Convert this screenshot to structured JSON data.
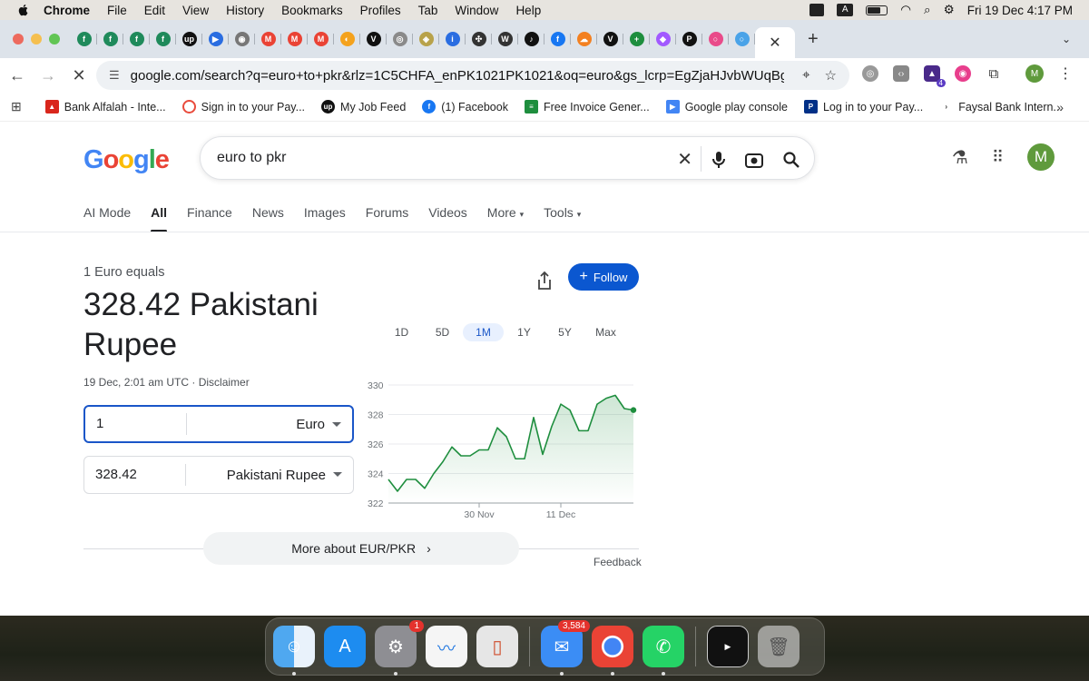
{
  "menubar": {
    "app": "Chrome",
    "items": [
      "File",
      "Edit",
      "View",
      "History",
      "Bookmarks",
      "Profiles",
      "Tab",
      "Window",
      "Help"
    ],
    "clock": "Fri 19 Dec  4:17 PM"
  },
  "browser": {
    "url": "google.com/search?q=euro+to+pkr&rlz=1C5CHFA_enPK1021PK1021&oq=euro&gs_lcrp=EgZjaHJvbWUqBggAEEU...",
    "ext_badge": "4",
    "profile_initial": "M"
  },
  "bookmarks": [
    "Bank Alfalah - Inte...",
    "Sign in to your Pay...",
    "My Job Feed",
    "(1) Facebook",
    "Free Invoice Gener...",
    "Google play console",
    "Log in to your Pay...",
    "Faysal Bank Intern..."
  ],
  "google": {
    "query": "euro to pkr",
    "profile_initial": "M",
    "tabs": [
      "AI Mode",
      "All",
      "Finance",
      "News",
      "Images",
      "Forums",
      "Videos",
      "More",
      "Tools"
    ]
  },
  "converter": {
    "equals": "1 Euro equals",
    "result": "328.42 Pakistani Rupee",
    "timestamp": "19 Dec, 2:01 am UTC · Disclaimer",
    "from_value": "1",
    "from_currency": "Euro",
    "to_value": "328.42",
    "to_currency": "Pakistani Rupee",
    "follow": "Follow",
    "more": "More about EUR/PKR",
    "feedback": "Feedback"
  },
  "ranges": [
    "1D",
    "5D",
    "1M",
    "1Y",
    "5Y",
    "Max"
  ],
  "selected_range": "1M",
  "chart_data": {
    "type": "area",
    "title": "",
    "xlabel": "",
    "ylabel": "",
    "ylim": [
      322,
      330
    ],
    "yticks": [
      322,
      324,
      326,
      328,
      330
    ],
    "xtick_labels": [
      "30 Nov",
      "11 Dec"
    ],
    "values": [
      323.6,
      322.8,
      323.6,
      323.6,
      323.0,
      324.0,
      324.8,
      325.8,
      325.2,
      325.2,
      325.6,
      325.6,
      327.1,
      326.5,
      325.0,
      325.0,
      327.8,
      325.3,
      327.2,
      328.7,
      328.3,
      326.9,
      326.9,
      328.7,
      329.1,
      329.3,
      328.4,
      328.3
    ],
    "line_color": "#1e8e3e"
  },
  "dock": {
    "mail_badge": "3,584",
    "settings_badge": "1"
  }
}
